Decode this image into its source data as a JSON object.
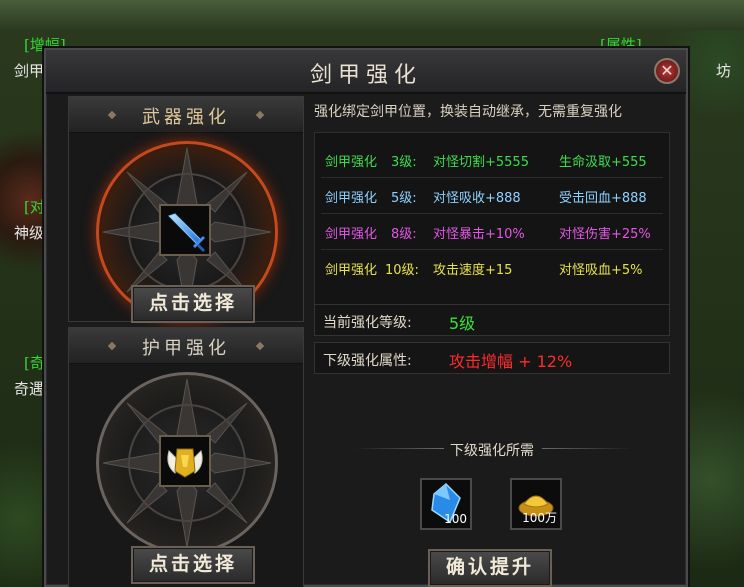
{
  "background_labels": {
    "left_top": "[增幅]",
    "left_1": "剑甲",
    "left_2": "[对",
    "left_3": "神级",
    "left_4": "[奇",
    "left_5": "奇遇",
    "right_top": "[属性]",
    "right_1": "坊"
  },
  "window": {
    "title": "剑甲强化",
    "close_glyph": "✕"
  },
  "weapon": {
    "header": "武器强化",
    "button": "点击选择"
  },
  "armor": {
    "header": "护甲强化",
    "button": "点击选择"
  },
  "description": "强化绑定剑甲位置，换装自动继承，无需重复强化",
  "tiers": [
    {
      "name": "剑甲强化",
      "level": "3级:",
      "attr1": "对怪切割+5555",
      "attr2": "生命汲取+555",
      "color": "#3fdc4f"
    },
    {
      "name": "剑甲强化",
      "level": "5级:",
      "attr1": "对怪吸收+888",
      "attr2": "受击回血+888",
      "color": "#8fd0ff"
    },
    {
      "name": "剑甲强化",
      "level": "8级:",
      "attr1": "对怪暴击+10%",
      "attr2": "对怪伤害+25%",
      "color": "#e257e6"
    },
    {
      "name": "剑甲强化",
      "level": "10级:",
      "attr1": "攻击速度+15",
      "attr2": "对怪吸血+5%",
      "color": "#e8e24a"
    }
  ],
  "current_level": {
    "label": "当前强化等级:",
    "value": "5级",
    "color": "#38e038"
  },
  "next_attr": {
    "label": "下级强化属性:",
    "value": "攻击增幅 + 12%",
    "color": "#ff2a2a"
  },
  "requirements": {
    "title": "下级强化所需",
    "items": [
      {
        "icon": "blue-crystal-icon",
        "count": "100"
      },
      {
        "icon": "gold-ingot-icon",
        "count": "100万"
      }
    ]
  },
  "confirm_button": "确认提升"
}
